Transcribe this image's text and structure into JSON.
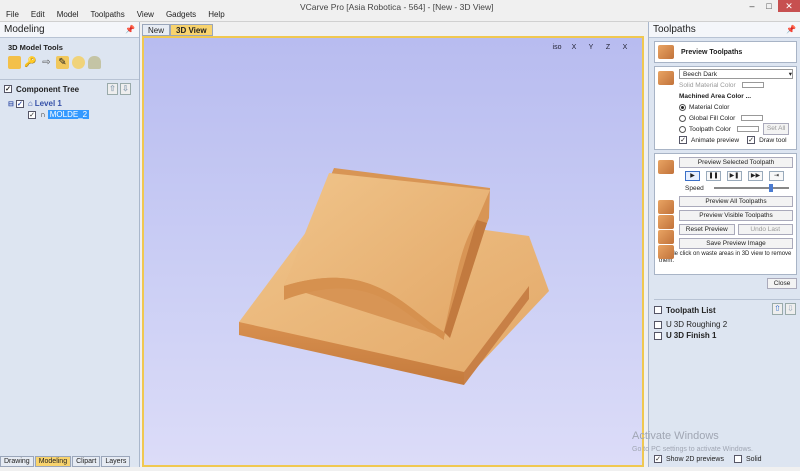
{
  "window": {
    "title": "VCarve Pro [Asia Robotica - 564] - [New - 3D View]",
    "minimize": "–",
    "maximize": "□",
    "close": "✕"
  },
  "menu": [
    "File",
    "Edit",
    "Model",
    "Toolpaths",
    "View",
    "Gadgets",
    "Help"
  ],
  "left_panel": {
    "title": "Modeling",
    "tools_title": "3D Model Tools",
    "component_tree_label": "Component Tree",
    "tree": {
      "level": "Level 1",
      "item": "MOLDE_2"
    },
    "bottom_tabs": [
      "Drawing",
      "Modeling",
      "Clipart",
      "Layers"
    ]
  },
  "view": {
    "tabs": [
      "New",
      "3D View"
    ],
    "view_icons": [
      "iso",
      "X",
      "Y",
      "Z",
      "X"
    ]
  },
  "right_panel": {
    "title": "Toolpaths",
    "preview_title": "Preview Toolpaths",
    "material": "Beech Dark",
    "solid_material_color": "Solid Material Color",
    "machined_area_color": "Machined Area Color ...",
    "material_color": "Material Color",
    "global_fill_color": "Global Fill Color",
    "toolpath_color": "Toolpath Color",
    "set_all": "Set All",
    "animate_preview": "Animate preview",
    "draw_tool": "Draw tool",
    "preview_selected": "Preview Selected Toolpath",
    "speed": "Speed",
    "preview_all": "Preview All Toolpaths",
    "preview_visible": "Preview Visible Toolpaths",
    "reset_preview": "Reset Preview",
    "undo_last": "Undo Last",
    "save_preview": "Save Preview Image",
    "hint": "Double click on waste areas in 3D view to remove them.",
    "close": "Close",
    "toolpath_list_label": "Toolpath List",
    "toolpaths": [
      "3D Roughing 2",
      "3D Finish 1"
    ],
    "show_2d_previews": "Show 2D previews",
    "solid": "Solid"
  },
  "watermark": {
    "line1": "Activate Windows",
    "line2": "Go to PC settings to activate Windows."
  },
  "colors": {
    "accent_tab": "#f8d36d",
    "viewport_bg": "#c4c8f3",
    "wood": "#e6a969"
  }
}
